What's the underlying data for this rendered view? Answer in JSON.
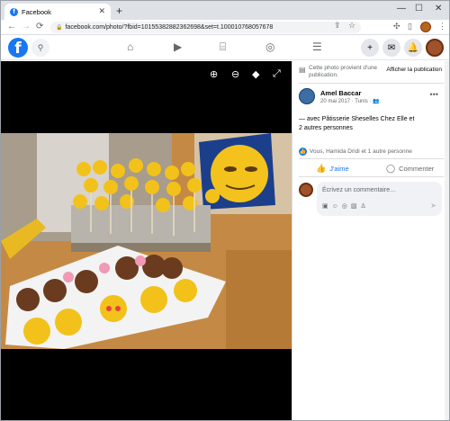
{
  "browser": {
    "tab_title": "Facebook",
    "url": "facebook.com/photo/?fbid=10155382882362698&set=t.100010768057678"
  },
  "photo_panel": {
    "notice": "Cette photo provient d'une publication.",
    "show_post": "Afficher la publication"
  },
  "post": {
    "author": "Amel Baccar",
    "meta": "20 mai 2017 · Tunis · ",
    "text": "— avec Pâtisserie Sheselles Chez Elle et",
    "text_link": "2 autres personnes",
    "reactions": "Vous, Hamida Dridi et 1 autre personne",
    "like_label": "J'aime",
    "comment_label": "Commenter",
    "comment_placeholder": "Écrivez un commentaire…"
  }
}
